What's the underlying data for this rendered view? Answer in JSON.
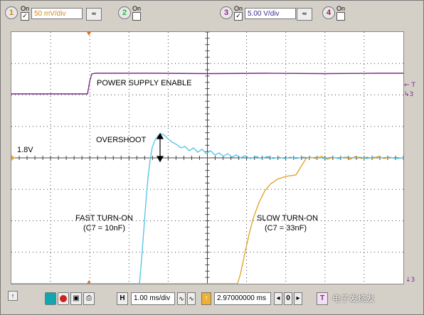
{
  "channels": [
    {
      "num": "1",
      "on_label": "On",
      "checked": true,
      "scale": "50 mV/div",
      "color": "#f0a030"
    },
    {
      "num": "2",
      "on_label": "On",
      "checked": false,
      "color": "#2bb24c"
    },
    {
      "num": "3",
      "on_label": "On",
      "checked": true,
      "scale": "5.00 V/div",
      "color": "#8a2a8a"
    },
    {
      "num": "4",
      "on_label": "On",
      "checked": false,
      "color": "#a02050"
    }
  ],
  "coupling_icon": "ac-coupling-icon",
  "annotations": {
    "power_supply_enable": "POWER SUPPLY ENABLE",
    "overshoot": "OVERSHOOT",
    "level": "1.8V",
    "fast_title": "FAST TURN-ON",
    "fast_cap": "(C7 = 10nF)",
    "slow_title": "SLOW TURN-ON",
    "slow_cap": "(C7 = 33nF)"
  },
  "edge_markers": {
    "trigger": "← T",
    "ch3": "↳3",
    "ch1_bottom": "↓3"
  },
  "traces": {
    "enable_color": "#7b2a8b",
    "fast_color": "#4dc3e6",
    "slow_color": "#e0a020",
    "grid_color": "#333333"
  },
  "bottom": {
    "left_marker": "↑",
    "horizontal_label": "H",
    "timebase": "1.00 ms/div",
    "trigger_label": "↑",
    "position": "2.97000000 ms",
    "trigger_mode": "T"
  },
  "watermark": "电子发烧友"
}
